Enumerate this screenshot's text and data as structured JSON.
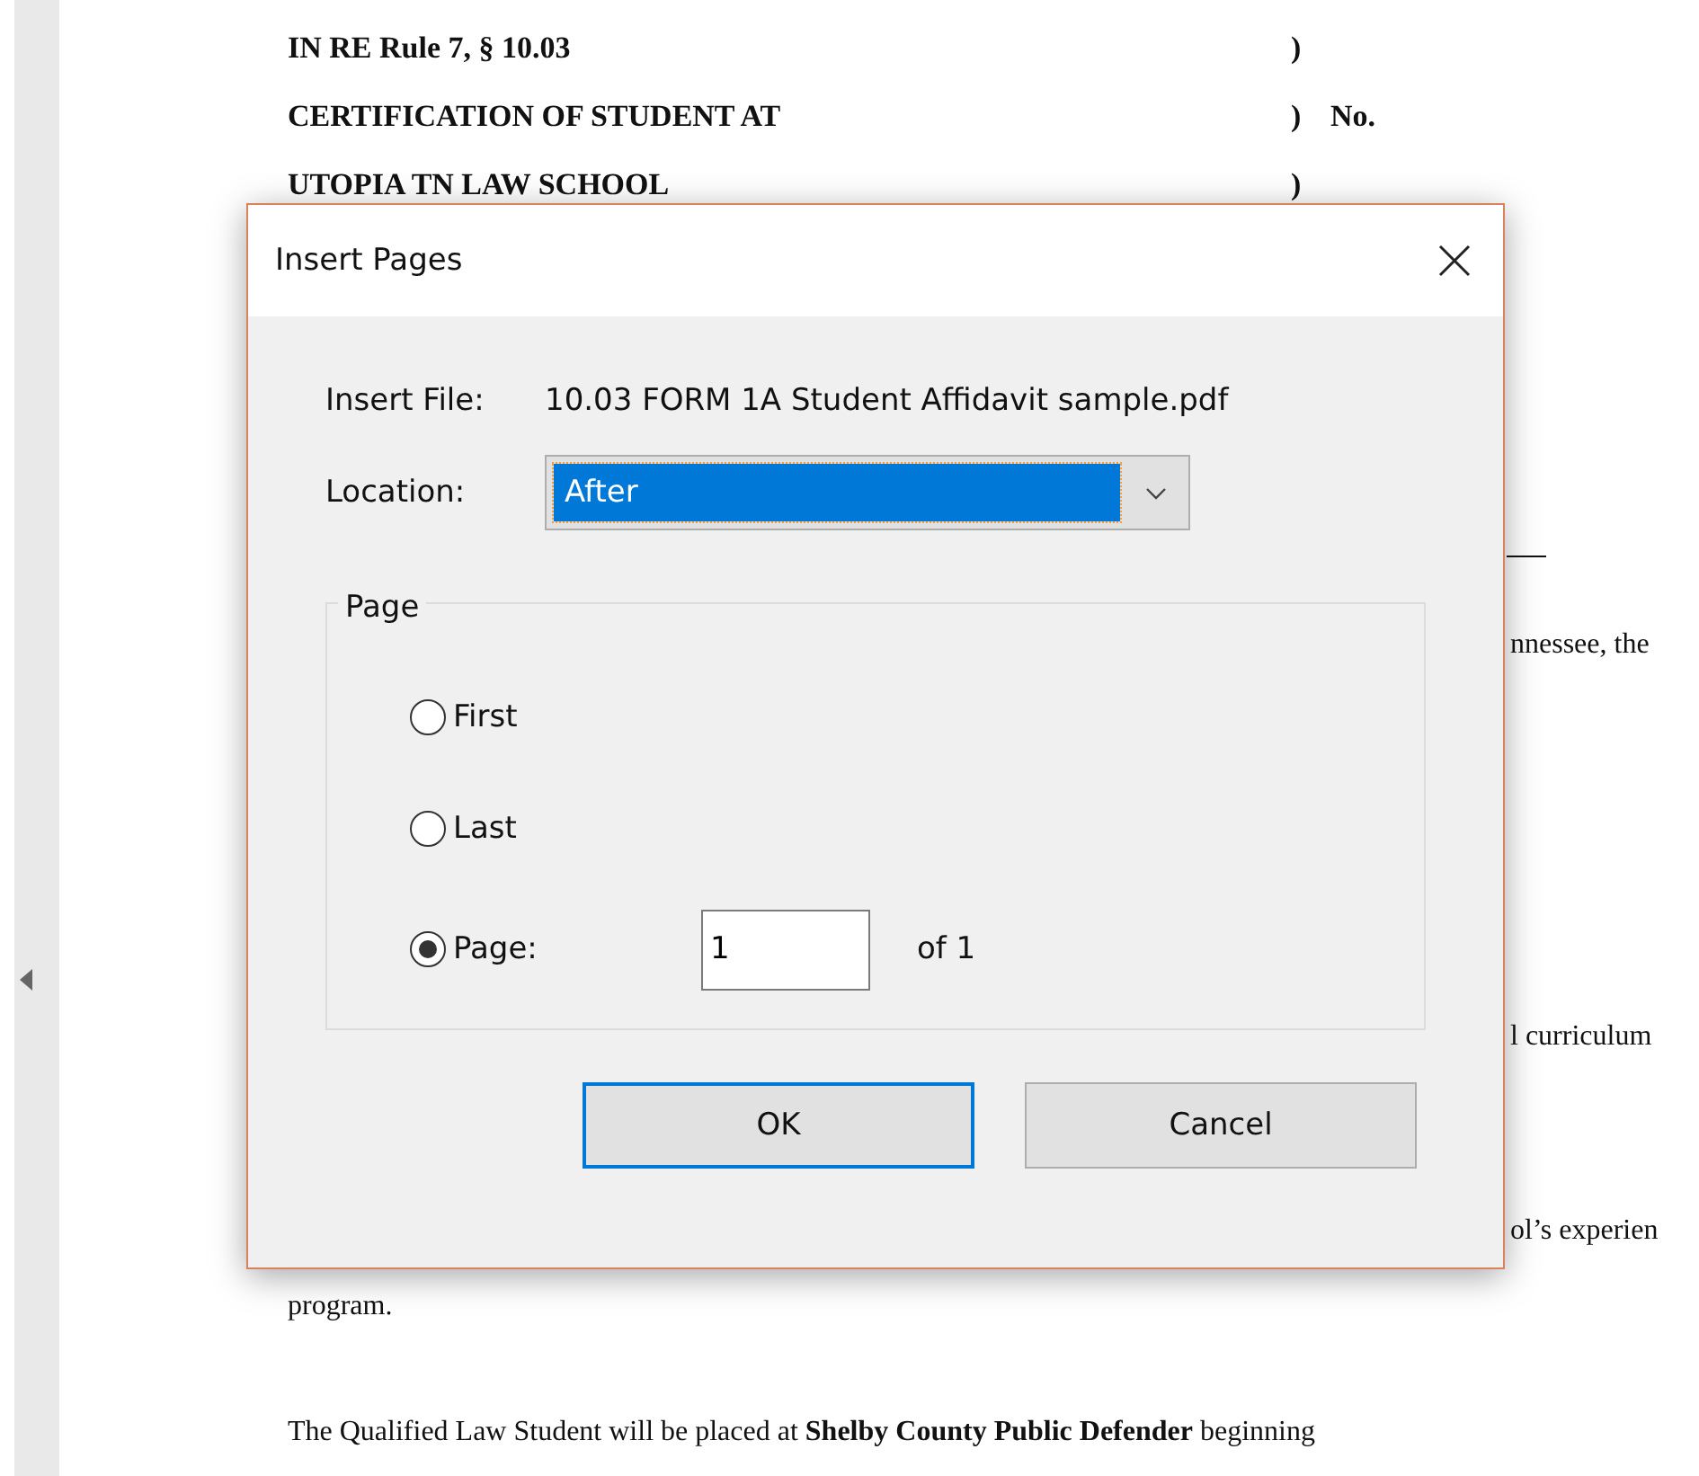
{
  "document": {
    "caption": [
      {
        "left": "IN RE Rule 7, § 10.03",
        "bracket": ")"
      },
      {
        "left": "CERTIFICATION OF STUDENT AT",
        "bracket": ")",
        "right": "No."
      },
      {
        "left": "UTOPIA TN LAW SCHOOL",
        "bracket": ")"
      }
    ],
    "fragments": [
      "nnessee, the",
      "l curriculum",
      "ol’s experien"
    ],
    "paragraphs": [
      "program.",
      "The Qualified Law Student will be placed at **Shelby County Public Defender** beginning"
    ]
  },
  "dialog": {
    "title": "Insert Pages",
    "file_label": "Insert File:",
    "file_name": "10.03 FORM 1A Student Affidavit sample.pdf",
    "location_label": "Location:",
    "location_value": "After",
    "group_label": "Page",
    "options": [
      {
        "label": "First",
        "selected": false
      },
      {
        "label": "Last",
        "selected": false
      },
      {
        "label": "Page:",
        "selected": true,
        "value": "1",
        "suffix": "of 1"
      }
    ],
    "buttons": [
      {
        "label": "OK",
        "default": true
      },
      {
        "label": "Cancel",
        "default": false
      }
    ]
  }
}
